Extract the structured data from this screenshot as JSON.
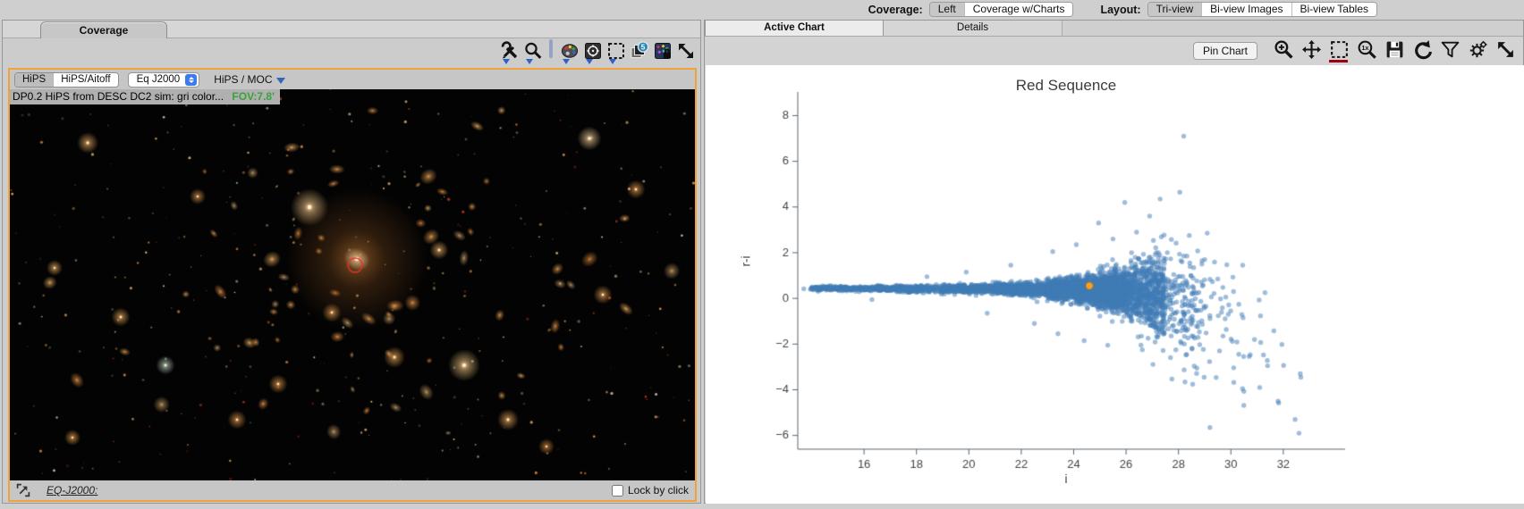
{
  "topbar": {
    "coverage_label": "Coverage:",
    "coverage_options": [
      {
        "label": "Left",
        "active": true
      },
      {
        "label": "Coverage w/Charts",
        "active": false
      }
    ],
    "layout_label": "Layout:",
    "layout_options": [
      {
        "label": "Tri-view",
        "active": true
      },
      {
        "label": "Bi-view Images",
        "active": false
      },
      {
        "label": "Bi-view Tables",
        "active": false
      }
    ]
  },
  "left_panel": {
    "tab": "Coverage",
    "toolbar_icons": [
      "tools",
      "zoom",
      "separator",
      "color-palette",
      "recenter",
      "select-area",
      "layers",
      "catalog-overlay-lock",
      "expand"
    ],
    "layers_badge_count": "5",
    "viewer": {
      "projection_options": [
        {
          "label": "HiPS",
          "active": true
        },
        {
          "label": "HiPS/Aitoff",
          "active": false
        }
      ],
      "coord_select_value": "Eq J2000",
      "hips_moc_label": "HiPS / MOC",
      "status_text": "DP0.2 HiPS from DESC DC2 sim: gri color...",
      "fov_label": "FOV:7.8'",
      "fov_color": "#3aa23a",
      "highlight_border_color": "#f2a13c",
      "marker_color": "#e93030",
      "bottom": {
        "readout_label": "EQ-J2000:",
        "lock_label": "Lock by click",
        "lock_checked": false
      }
    }
  },
  "right_panel": {
    "tabs": [
      {
        "label": "Active Chart",
        "active": true
      },
      {
        "label": "Details",
        "active": false
      }
    ],
    "pin_button": "Pin Chart",
    "zoom_original_label": "1x",
    "toolbar_icons": [
      "zoom-in",
      "pan",
      "select-area",
      "zoom-original",
      "save",
      "undo",
      "filter",
      "settings",
      "expand"
    ]
  },
  "chart_data": {
    "type": "scatter",
    "title": "Red Sequence",
    "xlabel": "i",
    "ylabel": "r-i",
    "xlim": [
      13.47,
      33.95
    ],
    "ylim": [
      -6.6,
      8.8
    ],
    "xticks": [
      16,
      18,
      20,
      22,
      24,
      26,
      28,
      30,
      32
    ],
    "yticks": [
      8,
      6,
      4,
      2,
      0,
      -2,
      -4,
      -6
    ],
    "grid": false,
    "legend": null,
    "point_color": "#3f7cb6",
    "point_alpha": 0.5,
    "point_radius": 2.7,
    "highlight_point": {
      "x": 24.6,
      "y": 0.55,
      "color": "#f0a12c"
    },
    "band_description": "dense red-sequence band at r-i ~ 0.4 that widens and fans out toward faint i magnitudes",
    "band_segments": [
      [
        13.95,
        16.5,
        260,
        0.44,
        0.43,
        0.045,
        0.055
      ],
      [
        16.5,
        19.0,
        330,
        0.43,
        0.42,
        0.055,
        0.075
      ],
      [
        19.0,
        21.0,
        430,
        0.42,
        0.42,
        0.075,
        0.105
      ],
      [
        21.0,
        23.0,
        780,
        0.42,
        0.4,
        0.105,
        0.16
      ],
      [
        23.0,
        24.5,
        1200,
        0.4,
        0.37,
        0.16,
        0.27
      ],
      [
        24.5,
        26.0,
        1500,
        0.37,
        0.29,
        0.27,
        0.48
      ],
      [
        26.0,
        27.5,
        720,
        0.29,
        0.02,
        0.48,
        1.0
      ],
      [
        27.5,
        29.0,
        170,
        0.02,
        -0.55,
        1.0,
        1.5
      ],
      [
        29.0,
        30.7,
        40,
        -0.55,
        -1.5,
        1.4,
        1.5
      ],
      [
        30.7,
        32.8,
        13,
        -1.7,
        -4.2,
        1.3,
        1.1
      ]
    ],
    "lead_points": [
      [
        13.7,
        0.42
      ]
    ],
    "outlier_points": [
      [
        28.2,
        7.1
      ],
      [
        28.05,
        4.65
      ],
      [
        27.3,
        4.35
      ],
      [
        25.95,
        4.2
      ],
      [
        26.9,
        3.6
      ],
      [
        24.95,
        3.3
      ],
      [
        26.4,
        2.9
      ],
      [
        25.5,
        2.6
      ],
      [
        24.1,
        2.35
      ],
      [
        23.2,
        2.05
      ],
      [
        21.6,
        1.45
      ],
      [
        19.9,
        1.15
      ],
      [
        18.4,
        0.95
      ],
      [
        29.2,
        -5.65
      ],
      [
        32.45,
        -5.3
      ],
      [
        32.6,
        -5.9
      ],
      [
        31.8,
        -4.5
      ],
      [
        31.1,
        -3.9
      ],
      [
        31.4,
        -2.95
      ],
      [
        30.3,
        -2.45
      ],
      [
        28.7,
        -3.05
      ],
      [
        27.9,
        -2.25
      ],
      [
        29.7,
        -1.65
      ],
      [
        25.3,
        -2.05
      ],
      [
        24.4,
        -1.85
      ],
      [
        23.4,
        -1.55
      ],
      [
        22.5,
        -1.1
      ],
      [
        20.7,
        -0.65
      ],
      [
        16.3,
        -0.05
      ],
      [
        30.1,
        0.3
      ],
      [
        29.5,
        0.85
      ],
      [
        28.9,
        1.65
      ],
      [
        28.5,
        -0.95
      ],
      [
        27.2,
        -1.7
      ],
      [
        29.9,
        -0.7
      ],
      [
        30.9,
        -1.8
      ]
    ]
  }
}
